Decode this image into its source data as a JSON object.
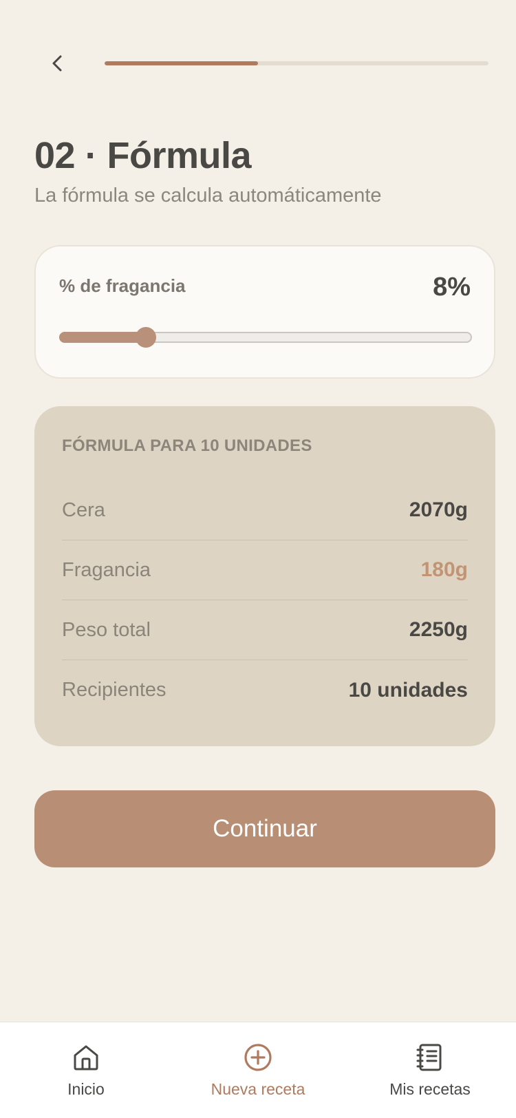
{
  "header": {
    "back_icon": "chevron-left-icon",
    "progress_fraction": 0.4
  },
  "title": "02 · Fórmula",
  "subtitle": "La fórmula se calcula automáticamente",
  "fragrance": {
    "label": "% de fragancia",
    "value_text": "8%",
    "slider_fraction": 0.21
  },
  "formula": {
    "heading": "FÓRMULA PARA 10 UNIDADES",
    "rows": [
      {
        "label": "Cera",
        "value": "2070g"
      },
      {
        "label": "Fragancia",
        "value": "180g"
      },
      {
        "label": "Peso total",
        "value": "2250g"
      },
      {
        "label": "Recipientes",
        "value": "10 unidades"
      }
    ]
  },
  "continue_label": "Continuar",
  "nav": {
    "items": [
      {
        "label": "Inicio",
        "icon": "home-icon"
      },
      {
        "label": "Nueva receta",
        "icon": "plus-circle-icon",
        "active": true
      },
      {
        "label": "Mis recetas",
        "icon": "notebook-icon"
      }
    ]
  },
  "colors": {
    "accent": "#b07a5e",
    "button": "#b88e75",
    "background": "#f4efe7",
    "card": "#ddd4c4"
  }
}
